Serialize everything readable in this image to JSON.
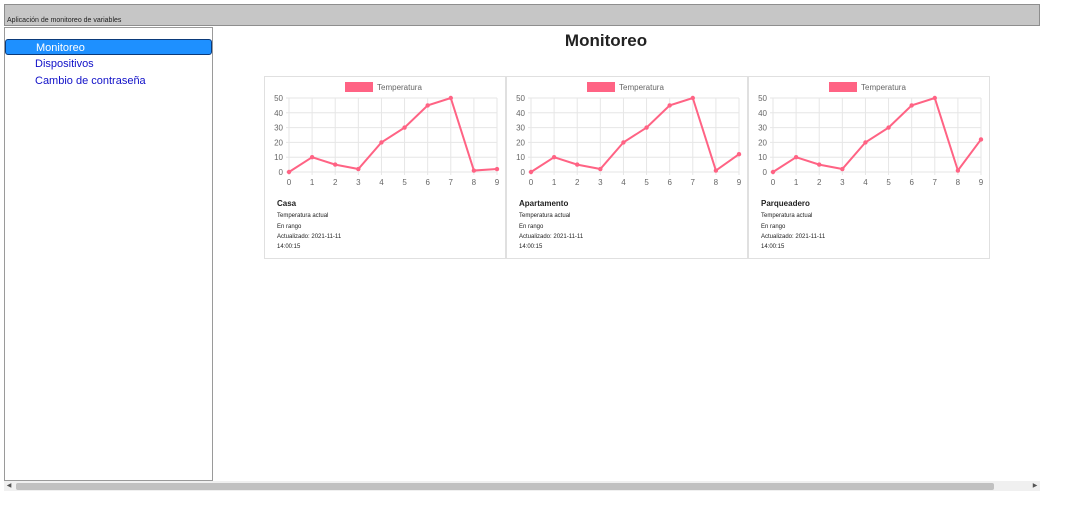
{
  "window": {
    "title": "Aplicación de monitoreo de variables"
  },
  "sidebar": {
    "items": [
      {
        "label": "Monitoreo",
        "active": true
      },
      {
        "label": "Dispositivos",
        "active": false
      },
      {
        "label": "Cambio de contraseña",
        "active": false
      }
    ]
  },
  "main": {
    "title": "Monitoreo"
  },
  "colors": {
    "series": "#ff6384",
    "accent": "#1e90ff",
    "link": "#1010c8"
  },
  "cards": [
    {
      "name": "Casa",
      "status_label": "Temperatura actual",
      "status": "En rango",
      "updated_label": "Actualizado: 2021-11-11",
      "updated_time": "14:00:15",
      "chart_data": {
        "type": "line",
        "series": [
          {
            "name": "Temperatura",
            "x": [
              0,
              1,
              2,
              3,
              4,
              5,
              6,
              7,
              8,
              9
            ],
            "values": [
              0,
              10,
              5,
              2,
              20,
              30,
              45,
              50,
              1,
              2
            ]
          }
        ],
        "ylim": [
          0,
          50
        ],
        "yticks": [
          0,
          10,
          20,
          30,
          40,
          50
        ],
        "xticks": [
          0,
          1,
          2,
          3,
          4,
          5,
          6,
          7,
          8,
          9
        ],
        "legend": "top-center",
        "grid": true
      }
    },
    {
      "name": "Apartamento",
      "status_label": "Temperatura actual",
      "status": "En rango",
      "updated_label": "Actualizado: 2021-11-11",
      "updated_time": "14:00:15",
      "chart_data": {
        "type": "line",
        "series": [
          {
            "name": "Temperatura",
            "x": [
              0,
              1,
              2,
              3,
              4,
              5,
              6,
              7,
              8,
              9
            ],
            "values": [
              0,
              10,
              5,
              2,
              20,
              30,
              45,
              50,
              1,
              12
            ]
          }
        ],
        "ylim": [
          0,
          50
        ],
        "yticks": [
          0,
          10,
          20,
          30,
          40,
          50
        ],
        "xticks": [
          0,
          1,
          2,
          3,
          4,
          5,
          6,
          7,
          8,
          9
        ],
        "legend": "top-center",
        "grid": true
      }
    },
    {
      "name": "Parqueadero",
      "status_label": "Temperatura actual",
      "status": "En rango",
      "updated_label": "Actualizado: 2021-11-11",
      "updated_time": "14:00:15",
      "chart_data": {
        "type": "line",
        "series": [
          {
            "name": "Temperatura",
            "x": [
              0,
              1,
              2,
              3,
              4,
              5,
              6,
              7,
              8,
              9
            ],
            "values": [
              0,
              10,
              5,
              2,
              20,
              30,
              45,
              50,
              1,
              22
            ]
          }
        ],
        "ylim": [
          0,
          50
        ],
        "yticks": [
          0,
          10,
          20,
          30,
          40,
          50
        ],
        "xticks": [
          0,
          1,
          2,
          3,
          4,
          5,
          6,
          7,
          8,
          9
        ],
        "legend": "top-center",
        "grid": true
      }
    }
  ],
  "scrollbar": {
    "left_icon": "chevron-left-icon",
    "right_icon": "chevron-right-icon"
  }
}
